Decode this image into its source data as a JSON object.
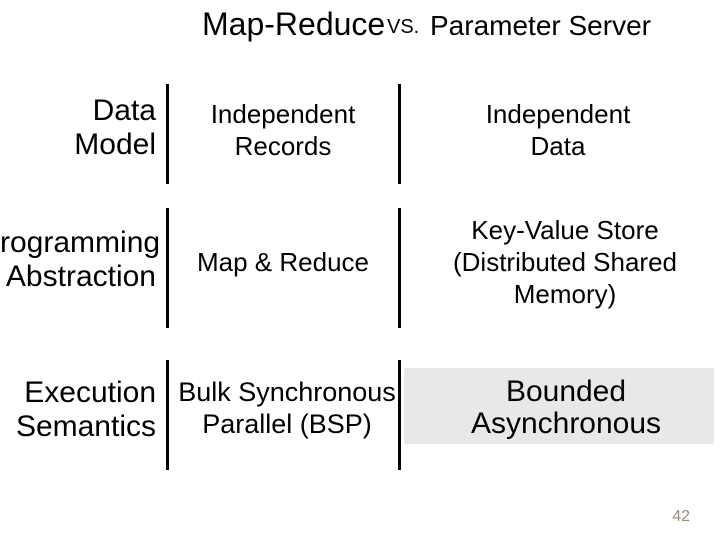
{
  "title": {
    "left": "Map-Reduce",
    "vs": "VS.",
    "right": "Parameter Server"
  },
  "rows": [
    {
      "label": "Data\nModel",
      "col1": "Independent\nRecords",
      "col2": "Independent\nData"
    },
    {
      "label": "Programming\nAbstraction",
      "col1": "Map & Reduce",
      "col2": "Key-Value Store\n(Distributed Shared\nMemory)"
    },
    {
      "label": "Execution\nSemantics",
      "col1": "Bulk Synchronous\nParallel (BSP)",
      "col2": "Bounded\nAsynchronous"
    }
  ],
  "page_number": "42"
}
